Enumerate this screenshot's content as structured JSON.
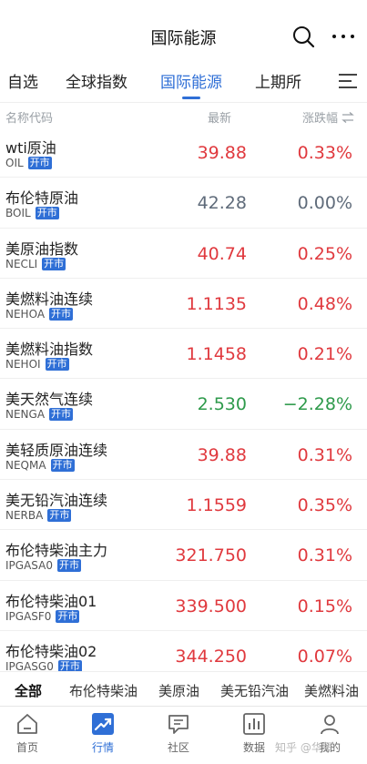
{
  "header": {
    "title": "国际能源"
  },
  "icons": {
    "search": "search-icon",
    "more": "more-icon",
    "menu": "menu-icon"
  },
  "colors": {
    "accent": "#2f6fd6",
    "up": "#e0393e",
    "down": "#2e9a4b",
    "flat": "#5f6b7a"
  },
  "tabs": [
    {
      "label": "自选"
    },
    {
      "label": "全球指数"
    },
    {
      "label": "国际能源",
      "active": true
    },
    {
      "label": "上期所"
    }
  ],
  "columns": {
    "name": "名称代码",
    "latest": "最新",
    "change": "涨跌幅"
  },
  "rows": [
    {
      "name": "wti原油",
      "code": "OIL",
      "badge": "开市",
      "price": "39.88",
      "change": "0.33%",
      "dir": "up"
    },
    {
      "name": "布伦特原油",
      "code": "BOIL",
      "badge": "开市",
      "price": "42.28",
      "change": "0.00%",
      "dir": "flat"
    },
    {
      "name": "美原油指数",
      "code": "NECLI",
      "badge": "开市",
      "price": "40.74",
      "change": "0.25%",
      "dir": "up"
    },
    {
      "name": "美燃料油连续",
      "code": "NEHOA",
      "badge": "开市",
      "price": "1.1135",
      "change": "0.48%",
      "dir": "up"
    },
    {
      "name": "美燃料油指数",
      "code": "NEHOI",
      "badge": "开市",
      "price": "1.1458",
      "change": "0.21%",
      "dir": "up"
    },
    {
      "name": "美天然气连续",
      "code": "NENGA",
      "badge": "开市",
      "price": "2.530",
      "change": "−2.28%",
      "dir": "down"
    },
    {
      "name": "美轻质原油连续",
      "code": "NEQMA",
      "badge": "开市",
      "price": "39.88",
      "change": "0.31%",
      "dir": "up"
    },
    {
      "name": "美无铅汽油连续",
      "code": "NERBA",
      "badge": "开市",
      "price": "1.1559",
      "change": "0.35%",
      "dir": "up"
    },
    {
      "name": "布伦特柴油主力",
      "code": "IPGASA0",
      "badge": "开市",
      "price": "321.750",
      "change": "0.31%",
      "dir": "up"
    },
    {
      "name": "布伦特柴油01",
      "code": "IPGASF0",
      "badge": "开市",
      "price": "339.500",
      "change": "0.15%",
      "dir": "up"
    },
    {
      "name": "布伦特柴油02",
      "code": "IPGASG0",
      "badge": "开市",
      "price": "344.250",
      "change": "0.07%",
      "dir": "up"
    }
  ],
  "subtabs": [
    {
      "label": "全部",
      "active": true
    },
    {
      "label": "布伦特柴油"
    },
    {
      "label": "美原油"
    },
    {
      "label": "美无铅汽油"
    },
    {
      "label": "美燃料油"
    }
  ],
  "nav": [
    {
      "label": "首页",
      "icon": "home-icon"
    },
    {
      "label": "行情",
      "icon": "trend-icon",
      "active": true
    },
    {
      "label": "社区",
      "icon": "chat-icon"
    },
    {
      "label": "数据",
      "icon": "bar-chart-icon"
    },
    {
      "label": "我的",
      "icon": "user-icon"
    }
  ],
  "watermark": "知乎 @华罕"
}
